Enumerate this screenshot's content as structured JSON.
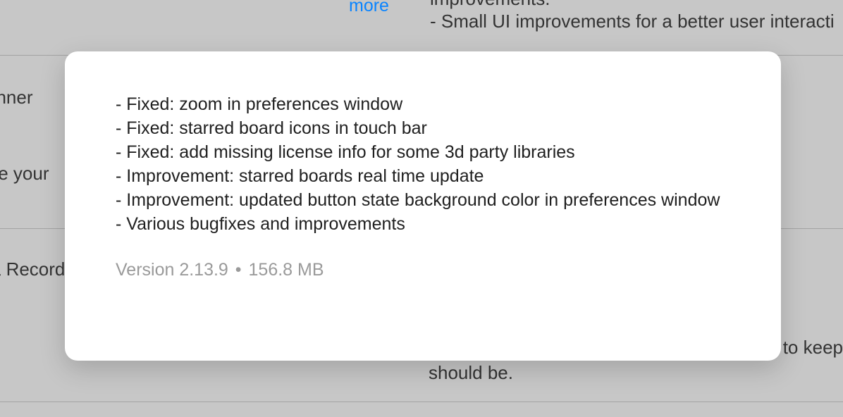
{
  "background": {
    "more_link": "more",
    "top_text_line1": "improvements.",
    "top_text_line2": "- Small UI improvements  for a better user interacti",
    "left_items": {
      "anner": "anner",
      "nize_your": "nize your",
      "recorder": "& Recorde"
    },
    "bottom_right_line1": "to keep",
    "bottom_right_line2": "should be."
  },
  "popover": {
    "notes": {
      "n0": "- Fixed: zoom in preferences window",
      "n1": "- Fixed: starred board icons in touch bar",
      "n2": "- Fixed: add missing license info for some 3d party libraries",
      "n3": "- Improvement: starred boards real time update",
      "n4": "- Improvement: updated button state background color in preferences window",
      "n5": "- Various bugfixes and improvements"
    },
    "version_label": "Version 2.13.9",
    "separator": "•",
    "size_label": "156.8 MB"
  }
}
